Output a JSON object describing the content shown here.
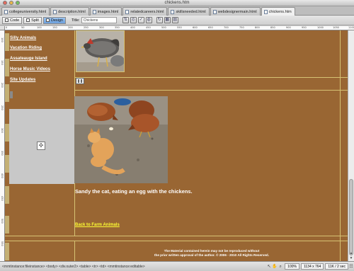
{
  "window": {
    "title": "chickens.htm"
  },
  "tabs": [
    {
      "label": "collegeuniversity.html"
    },
    {
      "label": "description.html"
    },
    {
      "label": "images.html"
    },
    {
      "label": "relatedcareers.html"
    },
    {
      "label": "skillsneeded.html"
    },
    {
      "label": "webdesignermain.html"
    },
    {
      "label": "chickens.htm"
    }
  ],
  "toolbar": {
    "code_label": "Code",
    "split_label": "Split",
    "design_label": "Design",
    "title_label": "Title:",
    "title_value": "Chickens"
  },
  "ruler": {
    "top_ticks": [
      "0",
      "50",
      "100",
      "150",
      "200",
      "250",
      "300",
      "350",
      "400",
      "450",
      "500",
      "550",
      "600",
      "650",
      "700",
      "750",
      "800",
      "850",
      "900",
      "950",
      "1000",
      "1050",
      "1100"
    ],
    "left_ticks": [
      "100",
      "150",
      "200",
      "250",
      "300",
      "350",
      "400",
      "450",
      "500",
      "550"
    ]
  },
  "nav": {
    "links": [
      {
        "label": "Silly Animals"
      },
      {
        "label": "Vacation Riding"
      },
      {
        "label": "Assateauge Island"
      },
      {
        "label": "Horse Music Videos"
      },
      {
        "label": "Site Updates"
      }
    ]
  },
  "content": {
    "caption": "Sandy the cat, eating an egg with the chickens.",
    "back_link": "Back to Farm Animals",
    "copyright_line1": "The Material contained herein may not be reproduced without",
    "copyright_line2": "the prior written approval of the author. © 2006 - 2010 All Rights Reserved."
  },
  "statusbar": {
    "tag_path": "<mmtinstance:fileinstance> <body> <div.outer2> <table> <tr> <td> <mmtinstance:editable>",
    "zoom": "100%",
    "dimensions": "1134 x 764",
    "filesize": "11K / 2 sec"
  },
  "colors": {
    "canvas_bg": "#996633",
    "link_yellow": "#ffff33",
    "guide": "#d6c273"
  }
}
